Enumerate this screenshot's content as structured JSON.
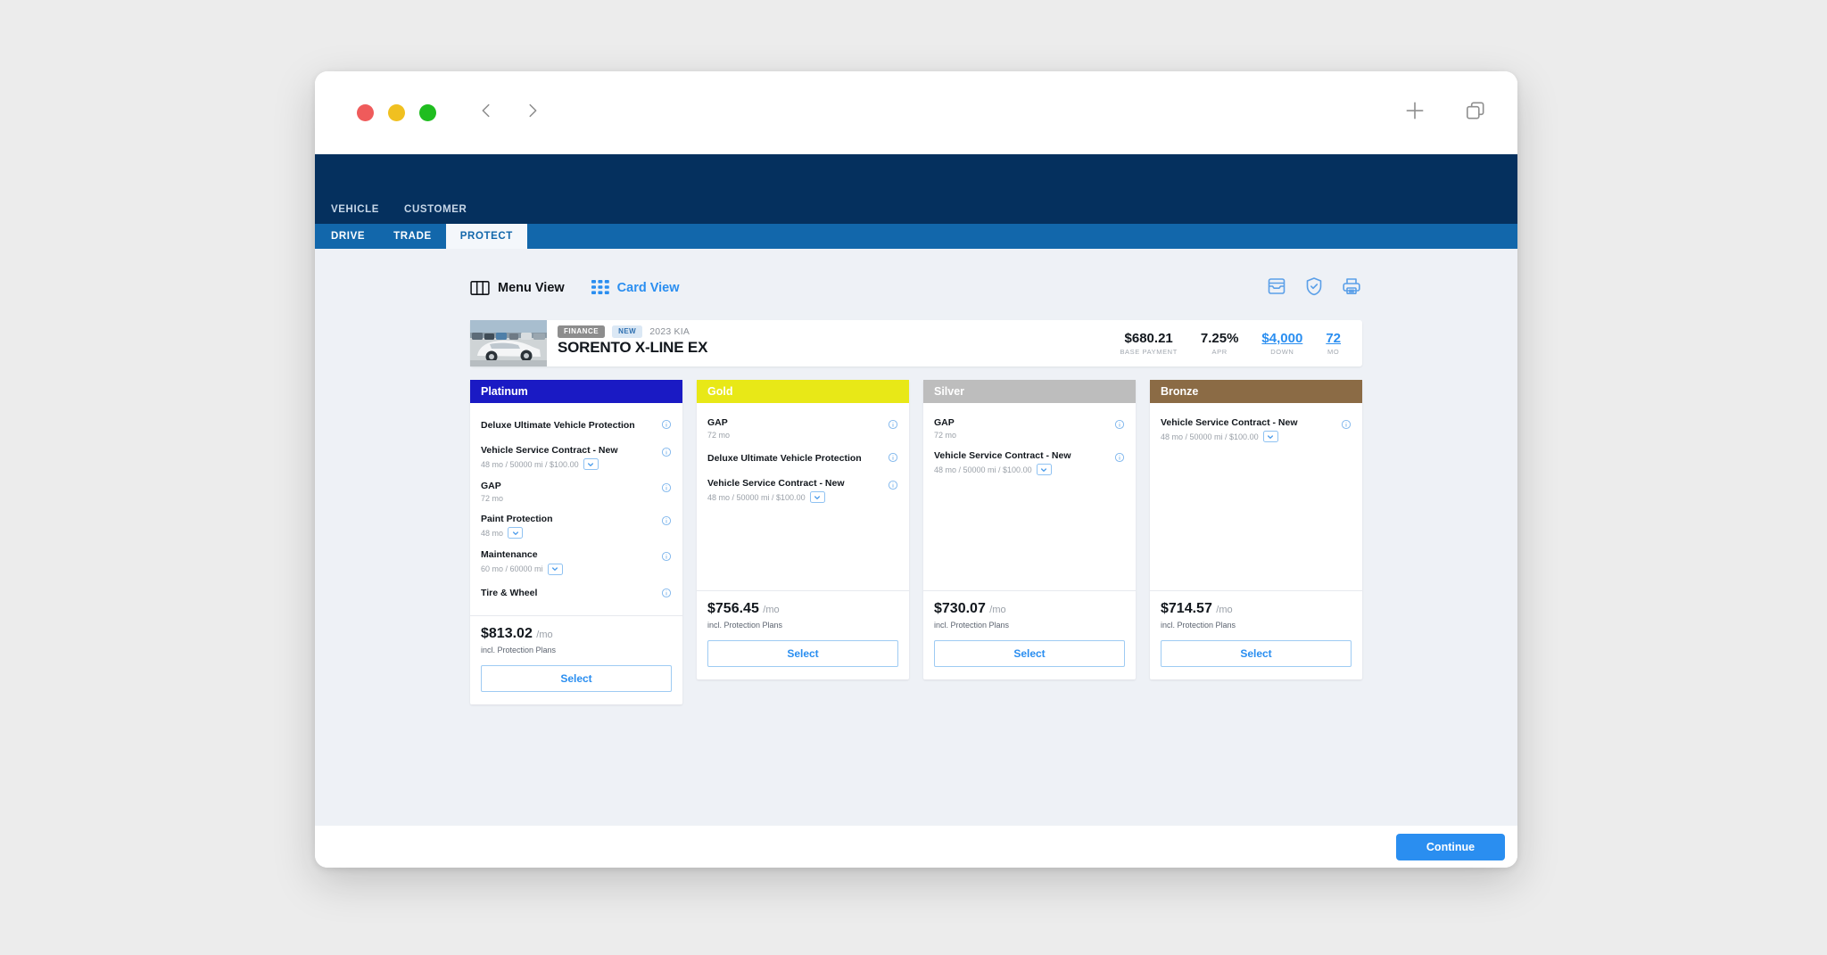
{
  "browser": {
    "search_placeholder": "",
    "search_value": "",
    "back_label": "Back",
    "forward_label": "Forward",
    "new_tab_label": "New Tab",
    "tabs_overview_label": "Show Tabs"
  },
  "app": {
    "top_tabs": [
      {
        "label": "VEHICLE",
        "active": false
      },
      {
        "label": "CUSTOMER",
        "active": false
      }
    ],
    "sub_tabs": [
      {
        "label": "DRIVE",
        "active": false
      },
      {
        "label": "TRADE",
        "active": false
      },
      {
        "label": "PROTECT",
        "active": true
      }
    ],
    "colors": {
      "header_blue": "#05305e",
      "subnav_blue": "#1267ab",
      "accent_blue": "#2a8ef0"
    }
  },
  "viewbar": {
    "menu_view_label": "Menu View",
    "card_view_label": "Card View",
    "tools": [
      {
        "name": "inbox-icon"
      },
      {
        "name": "shield-check-icon"
      },
      {
        "name": "printer-icon"
      }
    ]
  },
  "vehicle": {
    "deal_type": "FINANCE",
    "condition": "NEW",
    "year_make": "2023 KIA",
    "model": "SORENTO X-LINE EX",
    "stats": [
      {
        "value": "$680.21",
        "label": "BASE PAYMENT",
        "link": false
      },
      {
        "value": "7.25%",
        "label": "APR",
        "link": false
      },
      {
        "value": "$4,000",
        "label": "DOWN",
        "link": true
      },
      {
        "value": "72",
        "label": "MO",
        "link": true
      }
    ]
  },
  "plans": [
    {
      "name": "Platinum",
      "header_bg": "#1a1ac4",
      "header_color": "#ffffff",
      "items": [
        {
          "title": "Deluxe Ultimate Vehicle Protection",
          "sub": "",
          "has_select": false
        },
        {
          "title": "Vehicle Service Contract - New",
          "sub": "48 mo / 50000 mi / $100.00",
          "has_select": true
        },
        {
          "title": "GAP",
          "sub": "72 mo",
          "has_select": false
        },
        {
          "title": "Paint Protection",
          "sub": "48 mo",
          "has_select": true
        },
        {
          "title": "Maintenance",
          "sub": "60 mo / 60000 mi",
          "has_select": true
        },
        {
          "title": "Tire & Wheel",
          "sub": "",
          "has_select": false
        }
      ],
      "price": "$813.02",
      "per": "/mo",
      "incl": "incl. Protection Plans",
      "select_label": "Select"
    },
    {
      "name": "Gold",
      "header_bg": "#e8e817",
      "header_color": "#ffffff",
      "items": [
        {
          "title": "GAP",
          "sub": "72 mo",
          "has_select": false
        },
        {
          "title": "Deluxe Ultimate Vehicle Protection",
          "sub": "",
          "has_select": false
        },
        {
          "title": "Vehicle Service Contract - New",
          "sub": "48 mo / 50000 mi / $100.00",
          "has_select": true
        }
      ],
      "price": "$756.45",
      "per": "/mo",
      "incl": "incl. Protection Plans",
      "select_label": "Select"
    },
    {
      "name": "Silver",
      "header_bg": "#bdbdbd",
      "header_color": "#ffffff",
      "items": [
        {
          "title": "GAP",
          "sub": "72 mo",
          "has_select": false
        },
        {
          "title": "Vehicle Service Contract - New",
          "sub": "48 mo / 50000 mi / $100.00",
          "has_select": true
        }
      ],
      "price": "$730.07",
      "per": "/mo",
      "incl": "incl. Protection Plans",
      "select_label": "Select"
    },
    {
      "name": "Bronze",
      "header_bg": "#8b6b45",
      "header_color": "#ffffff",
      "items": [
        {
          "title": "Vehicle Service Contract - New",
          "sub": "48 mo / 50000 mi / $100.00",
          "has_select": true
        }
      ],
      "price": "$714.57",
      "per": "/mo",
      "incl": "incl. Protection Plans",
      "select_label": "Select"
    }
  ],
  "footer": {
    "continue_label": "Continue"
  }
}
